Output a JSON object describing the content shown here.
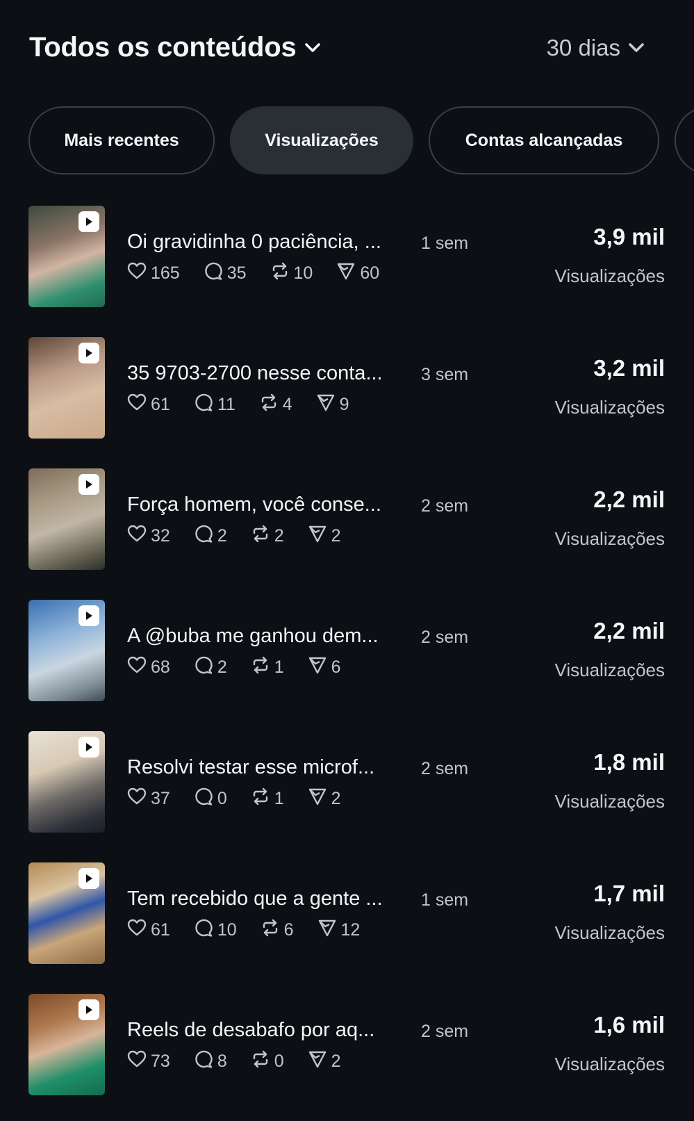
{
  "header": {
    "title": "Todos os conteúdos",
    "period": "30 dias"
  },
  "filters": [
    "Mais recentes",
    "Visualizações",
    "Contas alcançadas",
    ""
  ],
  "active_filter": "Visualizações",
  "posts": [
    {
      "title": "Oi gravidinha 0 paciência, ...",
      "age": "1 sem",
      "likes": "165",
      "comments": "35",
      "reposts": "10",
      "shares": "60",
      "views": "3,9 mil",
      "views_label": "Visualizações"
    },
    {
      "title": "35 9703-2700 nesse conta...",
      "age": "3 sem",
      "likes": "61",
      "comments": "11",
      "reposts": "4",
      "shares": "9",
      "views": "3,2 mil",
      "views_label": "Visualizações"
    },
    {
      "title": "Força homem, você conse...",
      "age": "2 sem",
      "likes": "32",
      "comments": "2",
      "reposts": "2",
      "shares": "2",
      "views": "2,2 mil",
      "views_label": "Visualizações"
    },
    {
      "title": "A @buba me ganhou dem...",
      "age": "2 sem",
      "likes": "68",
      "comments": "2",
      "reposts": "1",
      "shares": "6",
      "views": "2,2 mil",
      "views_label": "Visualizações"
    },
    {
      "title": "Resolvi testar esse microf...",
      "age": "2 sem",
      "likes": "37",
      "comments": "0",
      "reposts": "1",
      "shares": "2",
      "views": "1,8 mil",
      "views_label": "Visualizações"
    },
    {
      "title": "Tem recebido que a gente ...",
      "age": "1 sem",
      "likes": "61",
      "comments": "10",
      "reposts": "6",
      "shares": "12",
      "views": "1,7 mil",
      "views_label": "Visualizações"
    },
    {
      "title": "Reels de desabafo por aq...",
      "age": "2 sem",
      "likes": "73",
      "comments": "8",
      "reposts": "0",
      "shares": "2",
      "views": "1,6 mil",
      "views_label": "Visualizações"
    }
  ],
  "colors": {
    "background": "#0c0f14",
    "chip_active": "#2a2f36",
    "chip_border": "#3a3f47",
    "text_primary": "#f3f5f7",
    "text_secondary": "#c2c6cc"
  }
}
